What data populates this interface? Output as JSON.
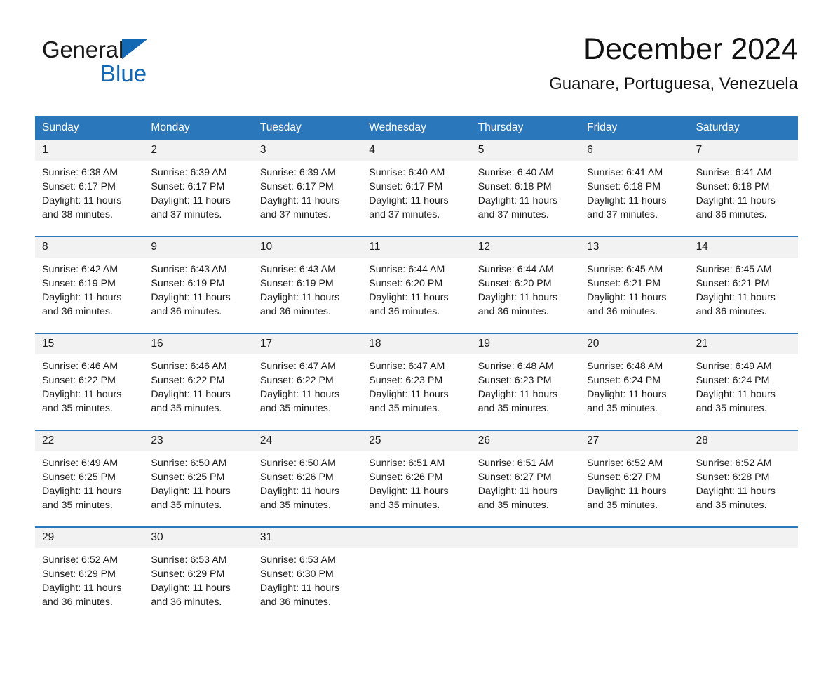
{
  "brand": {
    "name_dark": "General",
    "name_light": "Blue",
    "triangle_color": "#1268b3",
    "text_color": "#1a1a1a"
  },
  "header": {
    "title": "December 2024",
    "subtitle": "Guanare, Portuguesa, Venezuela"
  },
  "theme": {
    "accent": "#2b77bc",
    "daynum_bg": "#f2f2f2",
    "page_bg": "#ffffff"
  },
  "calendar": {
    "weekdays": [
      "Sunday",
      "Monday",
      "Tuesday",
      "Wednesday",
      "Thursday",
      "Friday",
      "Saturday"
    ],
    "weeks": [
      [
        {
          "day": "1",
          "sunrise": "Sunrise: 6:38 AM",
          "sunset": "Sunset: 6:17 PM",
          "daylight": "Daylight: 11 hours and 38 minutes."
        },
        {
          "day": "2",
          "sunrise": "Sunrise: 6:39 AM",
          "sunset": "Sunset: 6:17 PM",
          "daylight": "Daylight: 11 hours and 37 minutes."
        },
        {
          "day": "3",
          "sunrise": "Sunrise: 6:39 AM",
          "sunset": "Sunset: 6:17 PM",
          "daylight": "Daylight: 11 hours and 37 minutes."
        },
        {
          "day": "4",
          "sunrise": "Sunrise: 6:40 AM",
          "sunset": "Sunset: 6:17 PM",
          "daylight": "Daylight: 11 hours and 37 minutes."
        },
        {
          "day": "5",
          "sunrise": "Sunrise: 6:40 AM",
          "sunset": "Sunset: 6:18 PM",
          "daylight": "Daylight: 11 hours and 37 minutes."
        },
        {
          "day": "6",
          "sunrise": "Sunrise: 6:41 AM",
          "sunset": "Sunset: 6:18 PM",
          "daylight": "Daylight: 11 hours and 37 minutes."
        },
        {
          "day": "7",
          "sunrise": "Sunrise: 6:41 AM",
          "sunset": "Sunset: 6:18 PM",
          "daylight": "Daylight: 11 hours and 36 minutes."
        }
      ],
      [
        {
          "day": "8",
          "sunrise": "Sunrise: 6:42 AM",
          "sunset": "Sunset: 6:19 PM",
          "daylight": "Daylight: 11 hours and 36 minutes."
        },
        {
          "day": "9",
          "sunrise": "Sunrise: 6:43 AM",
          "sunset": "Sunset: 6:19 PM",
          "daylight": "Daylight: 11 hours and 36 minutes."
        },
        {
          "day": "10",
          "sunrise": "Sunrise: 6:43 AM",
          "sunset": "Sunset: 6:19 PM",
          "daylight": "Daylight: 11 hours and 36 minutes."
        },
        {
          "day": "11",
          "sunrise": "Sunrise: 6:44 AM",
          "sunset": "Sunset: 6:20 PM",
          "daylight": "Daylight: 11 hours and 36 minutes."
        },
        {
          "day": "12",
          "sunrise": "Sunrise: 6:44 AM",
          "sunset": "Sunset: 6:20 PM",
          "daylight": "Daylight: 11 hours and 36 minutes."
        },
        {
          "day": "13",
          "sunrise": "Sunrise: 6:45 AM",
          "sunset": "Sunset: 6:21 PM",
          "daylight": "Daylight: 11 hours and 36 minutes."
        },
        {
          "day": "14",
          "sunrise": "Sunrise: 6:45 AM",
          "sunset": "Sunset: 6:21 PM",
          "daylight": "Daylight: 11 hours and 36 minutes."
        }
      ],
      [
        {
          "day": "15",
          "sunrise": "Sunrise: 6:46 AM",
          "sunset": "Sunset: 6:22 PM",
          "daylight": "Daylight: 11 hours and 35 minutes."
        },
        {
          "day": "16",
          "sunrise": "Sunrise: 6:46 AM",
          "sunset": "Sunset: 6:22 PM",
          "daylight": "Daylight: 11 hours and 35 minutes."
        },
        {
          "day": "17",
          "sunrise": "Sunrise: 6:47 AM",
          "sunset": "Sunset: 6:22 PM",
          "daylight": "Daylight: 11 hours and 35 minutes."
        },
        {
          "day": "18",
          "sunrise": "Sunrise: 6:47 AM",
          "sunset": "Sunset: 6:23 PM",
          "daylight": "Daylight: 11 hours and 35 minutes."
        },
        {
          "day": "19",
          "sunrise": "Sunrise: 6:48 AM",
          "sunset": "Sunset: 6:23 PM",
          "daylight": "Daylight: 11 hours and 35 minutes."
        },
        {
          "day": "20",
          "sunrise": "Sunrise: 6:48 AM",
          "sunset": "Sunset: 6:24 PM",
          "daylight": "Daylight: 11 hours and 35 minutes."
        },
        {
          "day": "21",
          "sunrise": "Sunrise: 6:49 AM",
          "sunset": "Sunset: 6:24 PM",
          "daylight": "Daylight: 11 hours and 35 minutes."
        }
      ],
      [
        {
          "day": "22",
          "sunrise": "Sunrise: 6:49 AM",
          "sunset": "Sunset: 6:25 PM",
          "daylight": "Daylight: 11 hours and 35 minutes."
        },
        {
          "day": "23",
          "sunrise": "Sunrise: 6:50 AM",
          "sunset": "Sunset: 6:25 PM",
          "daylight": "Daylight: 11 hours and 35 minutes."
        },
        {
          "day": "24",
          "sunrise": "Sunrise: 6:50 AM",
          "sunset": "Sunset: 6:26 PM",
          "daylight": "Daylight: 11 hours and 35 minutes."
        },
        {
          "day": "25",
          "sunrise": "Sunrise: 6:51 AM",
          "sunset": "Sunset: 6:26 PM",
          "daylight": "Daylight: 11 hours and 35 minutes."
        },
        {
          "day": "26",
          "sunrise": "Sunrise: 6:51 AM",
          "sunset": "Sunset: 6:27 PM",
          "daylight": "Daylight: 11 hours and 35 minutes."
        },
        {
          "day": "27",
          "sunrise": "Sunrise: 6:52 AM",
          "sunset": "Sunset: 6:27 PM",
          "daylight": "Daylight: 11 hours and 35 minutes."
        },
        {
          "day": "28",
          "sunrise": "Sunrise: 6:52 AM",
          "sunset": "Sunset: 6:28 PM",
          "daylight": "Daylight: 11 hours and 35 minutes."
        }
      ],
      [
        {
          "day": "29",
          "sunrise": "Sunrise: 6:52 AM",
          "sunset": "Sunset: 6:29 PM",
          "daylight": "Daylight: 11 hours and 36 minutes."
        },
        {
          "day": "30",
          "sunrise": "Sunrise: 6:53 AM",
          "sunset": "Sunset: 6:29 PM",
          "daylight": "Daylight: 11 hours and 36 minutes."
        },
        {
          "day": "31",
          "sunrise": "Sunrise: 6:53 AM",
          "sunset": "Sunset: 6:30 PM",
          "daylight": "Daylight: 11 hours and 36 minutes."
        },
        {
          "day": "",
          "sunrise": "",
          "sunset": "",
          "daylight": ""
        },
        {
          "day": "",
          "sunrise": "",
          "sunset": "",
          "daylight": ""
        },
        {
          "day": "",
          "sunrise": "",
          "sunset": "",
          "daylight": ""
        },
        {
          "day": "",
          "sunrise": "",
          "sunset": "",
          "daylight": ""
        }
      ]
    ]
  }
}
